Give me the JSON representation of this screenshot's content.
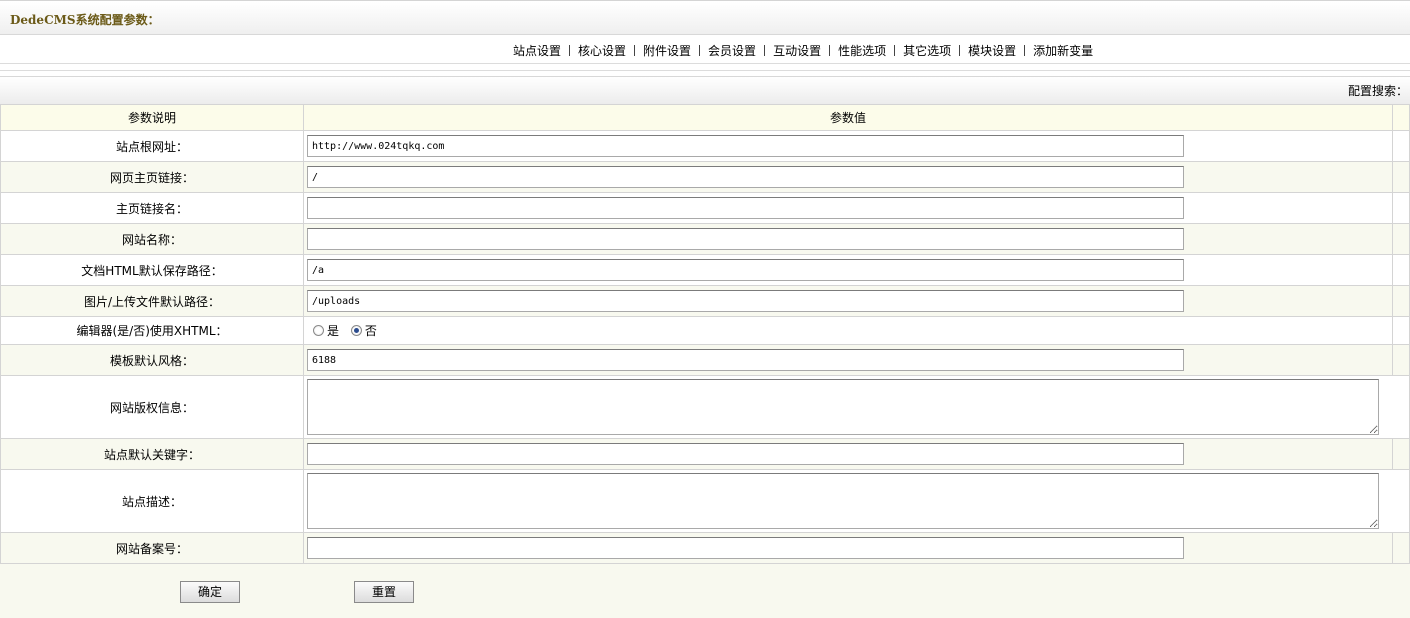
{
  "header": {
    "title": "DedeCMS系统配置参数："
  },
  "nav": {
    "items": [
      "站点设置",
      "核心设置",
      "附件设置",
      "会员设置",
      "互动设置",
      "性能选项",
      "其它选项",
      "模块设置",
      "添加新变量"
    ]
  },
  "search": {
    "label": "配置搜索："
  },
  "table": {
    "col1": "参数说明",
    "col2": "参数值",
    "rows": [
      {
        "label": "站点根网址：",
        "value": "http://www.024tqkq.com"
      },
      {
        "label": "网页主页链接：",
        "value": "/"
      },
      {
        "label": "主页链接名：",
        "value": ""
      },
      {
        "label": "网站名称：",
        "value": ""
      },
      {
        "label": "文档HTML默认保存路径：",
        "value": "/a"
      },
      {
        "label": "图片/上传文件默认路径：",
        "value": "/uploads"
      },
      {
        "label": "编辑器(是/否)使用XHTML：",
        "yes": "是",
        "no": "否",
        "selected": "否"
      },
      {
        "label": "模板默认风格：",
        "value": "6188"
      },
      {
        "label": "网站版权信息：",
        "value": ""
      },
      {
        "label": "站点默认关键字：",
        "value": ""
      },
      {
        "label": "站点描述：",
        "value": ""
      },
      {
        "label": "网站备案号：",
        "value": ""
      }
    ]
  },
  "buttons": {
    "submit": "确定",
    "reset": "重置"
  }
}
